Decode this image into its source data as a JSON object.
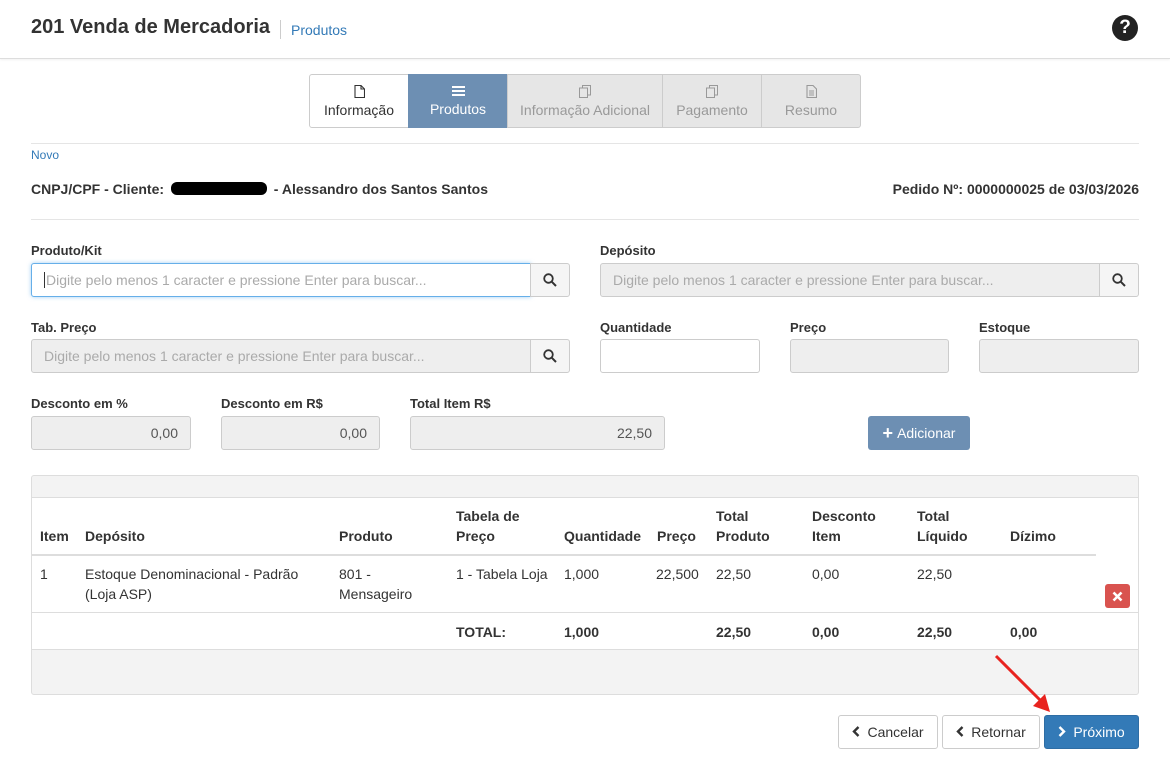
{
  "header": {
    "title": "201 Venda de Mercadoria",
    "breadcrumb": "Produtos",
    "help_icon": "question-circle-icon"
  },
  "wizard": {
    "tabs": [
      {
        "label": "Informação",
        "icon": "file-icon",
        "state": "done"
      },
      {
        "label": "Produtos",
        "icon": "list-icon",
        "state": "active"
      },
      {
        "label": "Informação Adicional",
        "icon": "copy-icon",
        "state": "disabled"
      },
      {
        "label": "Pagamento",
        "icon": "copy-icon",
        "state": "disabled"
      },
      {
        "label": "Resumo",
        "icon": "file-text-icon",
        "state": "disabled"
      }
    ]
  },
  "status_link": "Novo",
  "client": {
    "prefix": "CNPJ/CPF - Cliente:",
    "suffix": "- Alessandro dos Santos Santos"
  },
  "order": {
    "text": "Pedido Nº: 0000000025 de 03/03/2026"
  },
  "form": {
    "produto_kit": {
      "label": "Produto/Kit",
      "placeholder": "Digite pelo menos 1 caracter e pressione Enter para buscar..."
    },
    "deposito": {
      "label": "Depósito",
      "placeholder": "Digite pelo menos 1 caracter e pressione Enter para buscar..."
    },
    "tab_preco": {
      "label": "Tab. Preço",
      "placeholder": "Digite pelo menos 1 caracter e pressione Enter para buscar..."
    },
    "quantidade": {
      "label": "Quantidade",
      "value": ""
    },
    "preco": {
      "label": "Preço",
      "value": ""
    },
    "estoque": {
      "label": "Estoque",
      "value": ""
    },
    "desconto_pct": {
      "label": "Desconto em %",
      "value": "0,00"
    },
    "desconto_rs": {
      "label": "Desconto em R$",
      "value": "0,00"
    },
    "total_item": {
      "label": "Total Item R$",
      "value": "22,50"
    },
    "add_button": "Adicionar"
  },
  "table": {
    "headers": {
      "item": "Item",
      "deposito": "Depósito",
      "produto": "Produto",
      "tabela_1": "Tabela de",
      "tabela_2": "Preço",
      "quantidade": "Quantidade",
      "preco": "Preço",
      "total_produto_1": "Total",
      "total_produto_2": "Produto",
      "desconto_item_1": "Desconto",
      "desconto_item_2": "Item",
      "total_liquido_1": "Total",
      "total_liquido_2": "Líquido",
      "dizimo": "Dízimo"
    },
    "rows": [
      {
        "item": "1",
        "deposito_1": "Estoque Denominacional - Padrão",
        "deposito_2": "(Loja ASP)",
        "produto_1": "801 -",
        "produto_2": "Mensageiro",
        "tabela": "1 - Tabela Loja",
        "quantidade": "1,000",
        "preco": "22,500",
        "total_produto": "22,50",
        "desconto_item": "0,00",
        "total_liquido": "22,50",
        "dizimo": ""
      }
    ],
    "totals": {
      "label": "TOTAL:",
      "quantidade": "1,000",
      "total_produto": "22,50",
      "desconto_item": "0,00",
      "total_liquido": "22,50",
      "dizimo": "0,00"
    }
  },
  "footer": {
    "cancel": "Cancelar",
    "back": "Retornar",
    "next": "Próximo"
  },
  "colors": {
    "primary": "#337ab7",
    "active_tab": "#6d8fb3",
    "danger": "#d9534f",
    "annotation_arrow": "#e8231f"
  }
}
